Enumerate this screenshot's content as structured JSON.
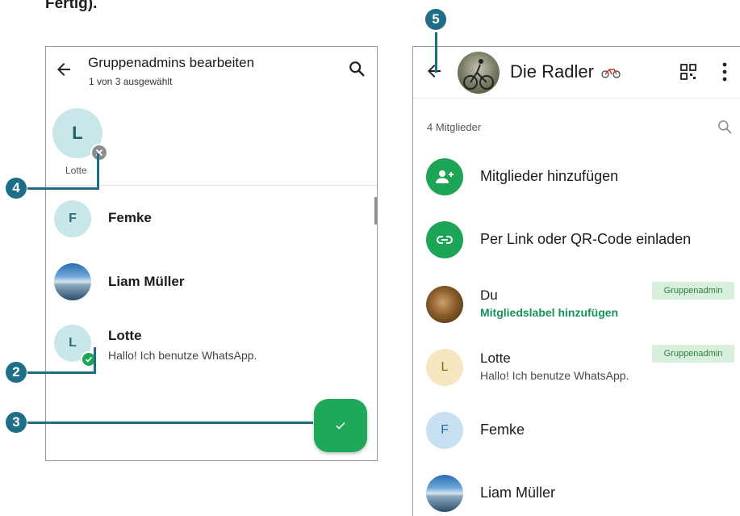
{
  "caption": {
    "text": "Fertig)."
  },
  "left_screen": {
    "header": {
      "title": "Gruppenadmins bearbeiten",
      "subtitle": "1 von 3 ausgewählt"
    },
    "selected": {
      "initial": "L",
      "name": "Lotte"
    },
    "contacts": [
      {
        "initial": "F",
        "name": "Femke",
        "status": ""
      },
      {
        "initial": "",
        "name": "Liam Müller",
        "status": ""
      },
      {
        "initial": "L",
        "name": "Lotte",
        "status": "Hallo! Ich benutze WhatsApp."
      }
    ]
  },
  "right_screen": {
    "header": {
      "title": "Die Radler"
    },
    "members_count": "4 Mitglieder",
    "actions": [
      {
        "label": "Mitglieder hinzufügen",
        "icon": "add-person-icon"
      },
      {
        "label": "Per Link oder QR-Code einladen",
        "icon": "link-icon"
      }
    ],
    "members": [
      {
        "initial": "",
        "name": "Du",
        "sub": "Mitgliedslabel hinzufügen",
        "badge": "Gruppenadmin"
      },
      {
        "initial": "L",
        "name": "Lotte",
        "sub": "Hallo! Ich benutze WhatsApp.",
        "badge": "Gruppenadmin"
      },
      {
        "initial": "F",
        "name": "Femke",
        "sub": "",
        "badge": ""
      },
      {
        "initial": "",
        "name": "Liam Müller",
        "sub": "",
        "badge": ""
      }
    ]
  },
  "callouts": [
    "2",
    "3",
    "4",
    "5"
  ],
  "colors": {
    "whatsapp_green": "#1fa85a",
    "callout_teal": "#1d6e86",
    "admin_badge_bg": "#d8efdc"
  }
}
